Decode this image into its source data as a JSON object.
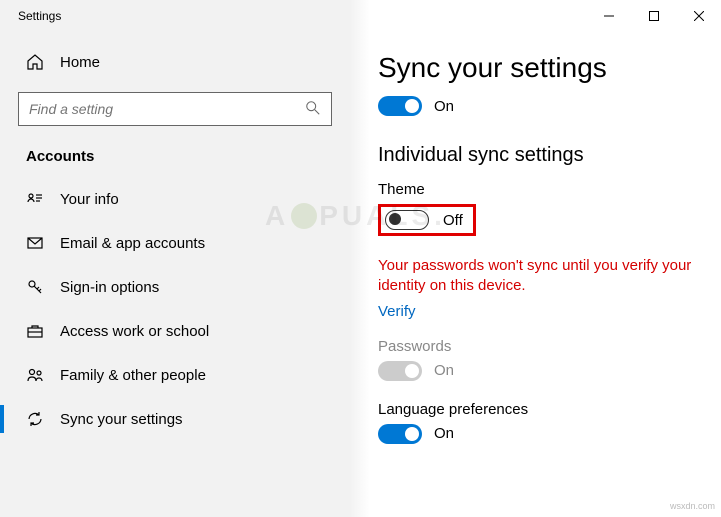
{
  "window": {
    "title": "Settings"
  },
  "sidebar": {
    "home": "Home",
    "search_placeholder": "Find a setting",
    "section": "Accounts",
    "items": [
      {
        "label": "Your info"
      },
      {
        "label": "Email & app accounts"
      },
      {
        "label": "Sign-in options"
      },
      {
        "label": "Access work or school"
      },
      {
        "label": "Family & other people"
      },
      {
        "label": "Sync your settings"
      }
    ]
  },
  "main": {
    "heading": "Sync your settings",
    "master_toggle": {
      "state": "On"
    },
    "subheading": "Individual sync settings",
    "theme": {
      "label": "Theme",
      "state": "Off"
    },
    "warning": "Your passwords won't sync until you verify your identity on this device.",
    "verify": "Verify",
    "passwords": {
      "label": "Passwords",
      "state": "On"
    },
    "lang": {
      "label": "Language preferences",
      "state": "On"
    }
  },
  "watermark_site": "wsxdn.com",
  "watermark_logo": "A  PUALS."
}
